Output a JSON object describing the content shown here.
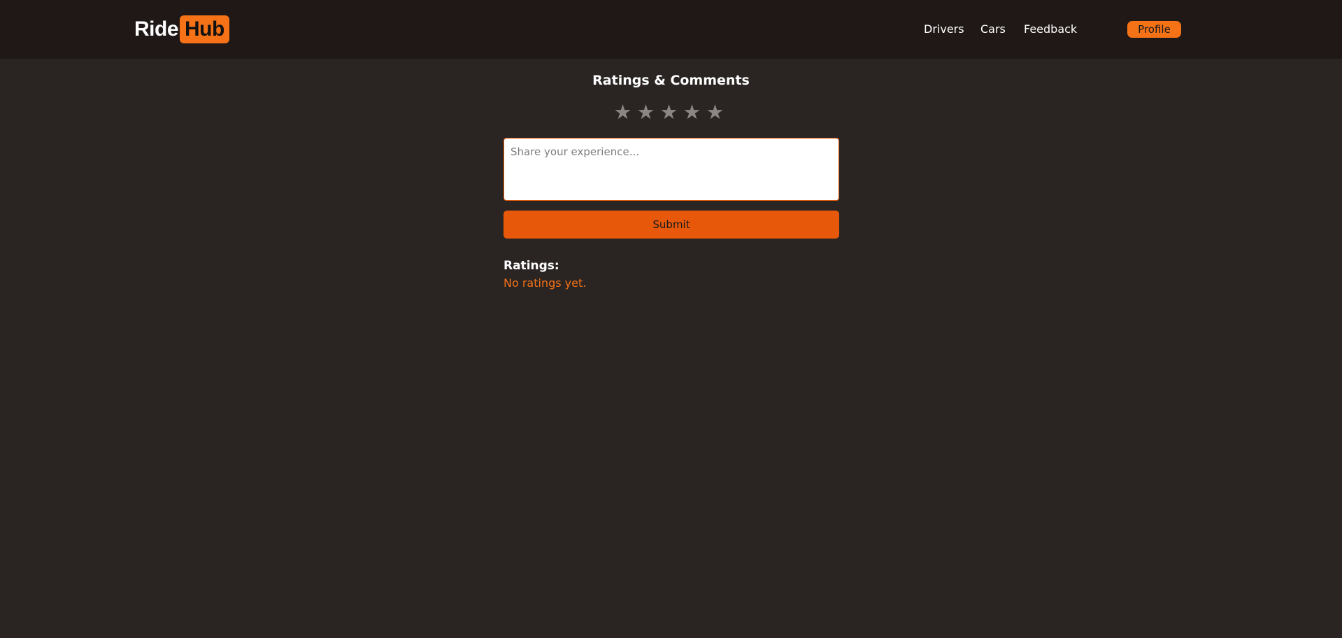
{
  "brand": {
    "part1": "Ride",
    "part2": "Hub",
    "accent_color": "#f57216"
  },
  "nav": {
    "links": [
      {
        "label": "Drivers"
      },
      {
        "label": "Cars"
      },
      {
        "label": "Feedback"
      }
    ],
    "profile_label": "Profile"
  },
  "main": {
    "title": "Ratings & Comments",
    "stars": {
      "max": 5,
      "selected": 0,
      "icon": "star-icon",
      "glyph": "★"
    },
    "comment": {
      "placeholder": "Share your experience...",
      "value": ""
    },
    "submit_label": "Submit",
    "ratings_heading": "Ratings:",
    "ratings_empty": "No ratings yet."
  },
  "colors": {
    "background": "#2a2523",
    "navbar": "#1f1816",
    "button": "#e8580b",
    "star_inactive": "#8b8683"
  }
}
